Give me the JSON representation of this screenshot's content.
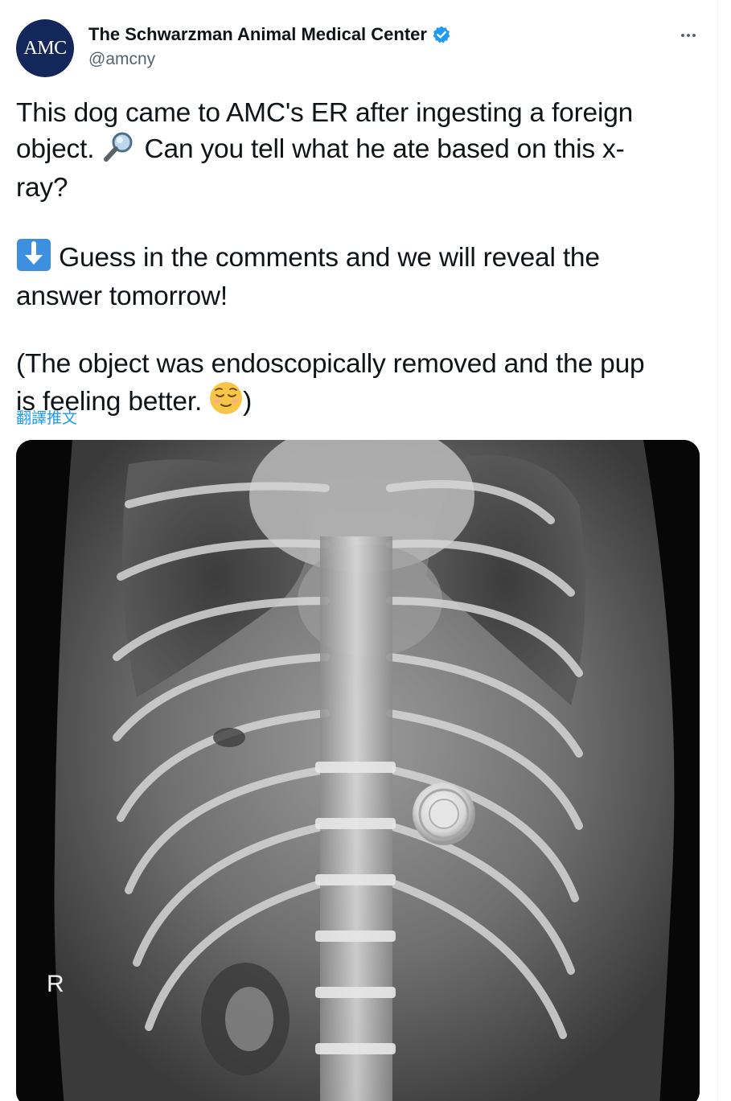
{
  "author": {
    "avatar_text": "AMC",
    "display_name": "The Schwarzman Animal Medical Center",
    "handle": "@amcny",
    "verified": true,
    "brand_color": "#14275a"
  },
  "tweet": {
    "line1": "This dog came to AMC's ER after ingesting a foreign",
    "line2a": "object.",
    "line2b": "Can you tell what he ate based on this x-",
    "line3": "ray?",
    "para2a": "Guess in the comments and we will reveal the",
    "para2b": "answer tomorrow!",
    "para3a": "(The object was endoscopically removed and the pup",
    "para3b": "is feeling better.",
    "para3c": ")",
    "emojis": [
      "magnifying-glass-icon",
      "down-arrow-icon",
      "relieved-face-icon"
    ]
  },
  "translate_label": "翻譯推文",
  "media": {
    "image_label": "R"
  },
  "colors": {
    "link": "#1d9bf0",
    "secondary_text": "#536471",
    "verified": "#1d9bf0"
  }
}
